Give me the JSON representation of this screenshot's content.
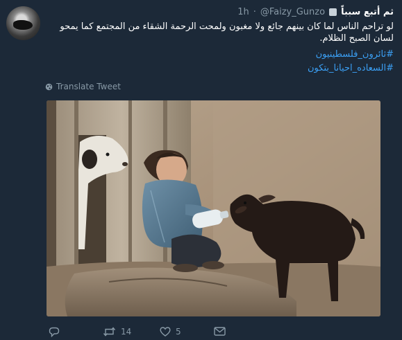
{
  "tweet": {
    "display_name": "ثم أتبع سبباً",
    "handle": "@Faizy_Gunzo",
    "separator": "·",
    "time": "1h",
    "text": "لو تراحم الناس لما كان بينهم جائع ولا مغبون ولمحت الرحمة الشقاء من المجتمع كما يمحو لسان الصبح الظلام.",
    "hashtags": [
      "#ثائرون_فلسطينيون",
      "#السعاده_احيانا_بتكون"
    ],
    "translate_label": "Translate Tweet"
  },
  "actions": {
    "reply_count": "",
    "retweet_count": "14",
    "like_count": "5"
  },
  "colors": {
    "background": "#1c2938",
    "link": "#3ba0f5",
    "muted": "#8899a6"
  },
  "icons": [
    "globe-icon",
    "reply-icon",
    "retweet-icon",
    "heart-icon",
    "mail-icon"
  ]
}
